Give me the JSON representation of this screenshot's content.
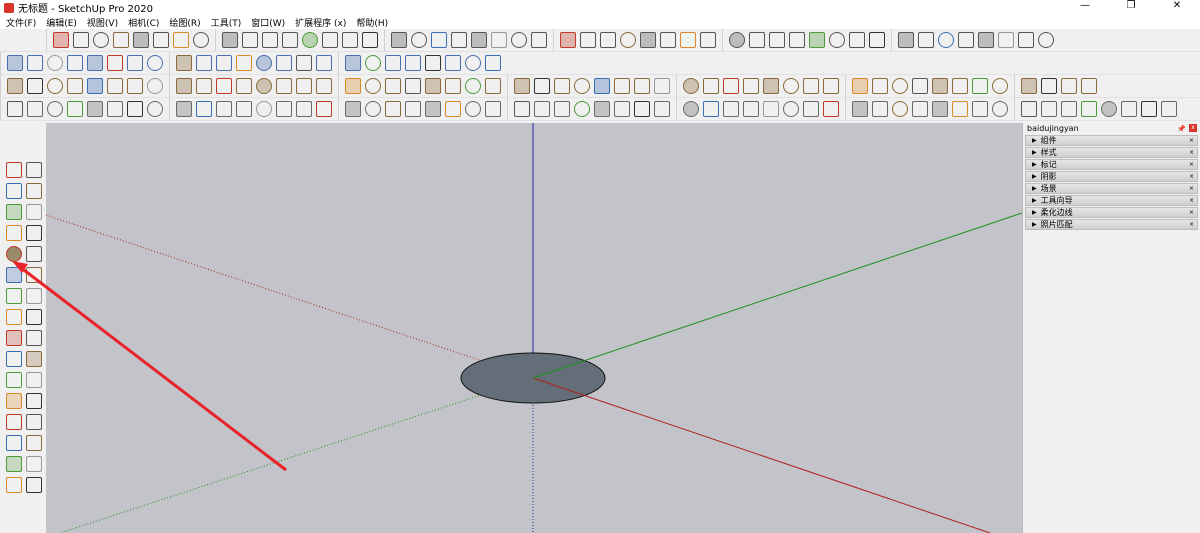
{
  "window": {
    "title": "无标题 - SketchUp Pro 2020",
    "minimize": "—",
    "maximize": "❐",
    "close": "✕"
  },
  "menu": [
    "文件(F)",
    "编辑(E)",
    "视图(V)",
    "相机(C)",
    "绘图(R)",
    "工具(T)",
    "窗口(W)",
    "扩展程序 (x)",
    "帮助(H)"
  ],
  "toolbars": {
    "row1": {
      "count": 48,
      "color": "#555555"
    },
    "row2": {
      "count": 24,
      "color": "#4a6fb0"
    },
    "row3": {
      "count": 52,
      "color": "#8a6a3a"
    },
    "row4": {
      "count": 56,
      "color": "#6a6a6a"
    }
  },
  "left_toolbar": {
    "icons": [
      "select",
      "eraser-cube",
      "paint-bucket",
      "eraser",
      "line",
      "freehand",
      "rectangle",
      "rotated-rectangle",
      "circle",
      "polygon",
      "arc",
      "pie",
      "arc-2point",
      "arc-3point",
      "move",
      "push-pull",
      "rotate",
      "follow-me",
      "scale",
      "offset",
      "tape-measure",
      "text",
      "protractor",
      "axes",
      "dimension",
      "3d-text",
      "orbit",
      "pan",
      "zoom",
      "zoom-window",
      "zoom-extents",
      "previous"
    ],
    "circle_highlight": "circle"
  },
  "panel": {
    "title": "baidujingyan",
    "pin": "📌",
    "close": "x",
    "items": [
      "组件",
      "样式",
      "标记",
      "阴影",
      "场景",
      "工具向导",
      "柔化边线",
      "照片匹配"
    ],
    "item_close": "×",
    "expand": "▶"
  },
  "colors": {
    "viewport": "#c3c4c9",
    "red_axis": "#b02020",
    "green_axis": "#1f8f1f",
    "blue_axis": "#2020a0",
    "circle_fill": "#636e78",
    "annotation_arrow": "#e8232a"
  }
}
